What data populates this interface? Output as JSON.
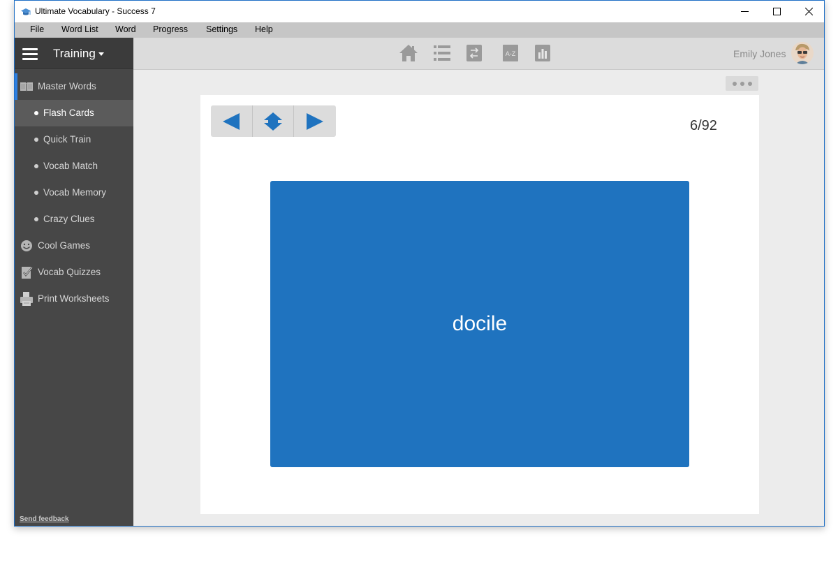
{
  "window": {
    "title": "Ultimate Vocabulary - Success 7",
    "controls": [
      "minimize-icon",
      "maximize-icon",
      "close-icon"
    ]
  },
  "menu": [
    "File",
    "Word List",
    "Word",
    "Progress",
    "Settings",
    "Help"
  ],
  "sidebar": {
    "mode_label": "Training",
    "items": [
      {
        "label": "Master Words",
        "icon": "book-icon",
        "level": "main",
        "accent": true
      },
      {
        "label": "Flash Cards",
        "level": "sub",
        "selected": true
      },
      {
        "label": "Quick Train",
        "level": "sub"
      },
      {
        "label": "Vocab Match",
        "level": "sub"
      },
      {
        "label": "Vocab Memory",
        "level": "sub"
      },
      {
        "label": "Crazy Clues",
        "level": "sub"
      },
      {
        "label": "Cool Games",
        "icon": "smiley-icon",
        "level": "main"
      },
      {
        "label": "Vocab Quizzes",
        "icon": "checklist-icon",
        "level": "main"
      },
      {
        "label": "Print Worksheets",
        "icon": "printer-icon",
        "level": "main"
      }
    ],
    "feedback_link": "Send feedback"
  },
  "toolbar": {
    "icons": [
      "home-icon",
      "list-icon",
      "swap-icon",
      "az-icon",
      "chart-icon"
    ],
    "az_label": "A-Z",
    "user_name": "Emily Jones"
  },
  "flashcard": {
    "counter": "6/92",
    "word": "docile",
    "nav": [
      "previous-arrow-icon",
      "flip-icon",
      "next-arrow-icon"
    ]
  },
  "colors": {
    "card": "#1f73bf",
    "nav_arrow": "#1f73bf",
    "sidebar": "#474747",
    "accent": "#2e7fe0"
  }
}
